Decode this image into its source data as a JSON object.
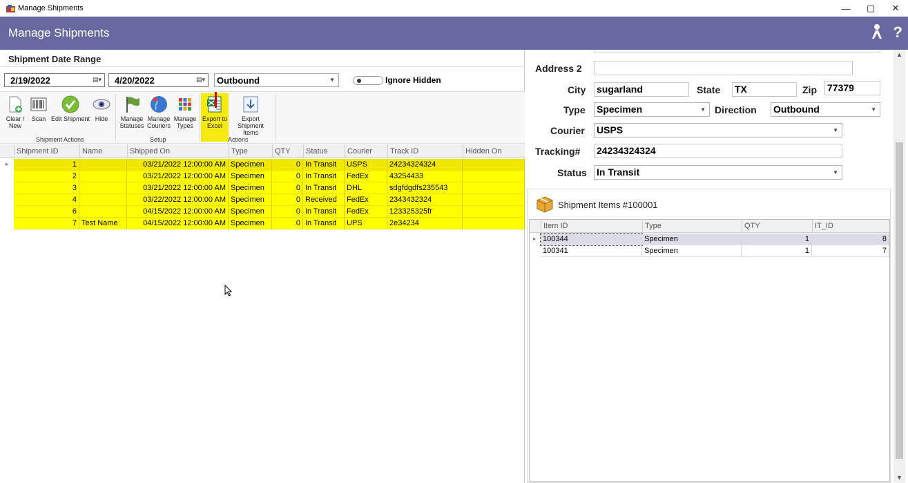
{
  "window": {
    "title": "Manage Shipments"
  },
  "header": {
    "title": "Manage Shipments"
  },
  "filters": {
    "section_label": "Shipment Date Range",
    "start_date": "2/19/2022",
    "end_date": "4/20/2022",
    "direction": "Outbound",
    "ignore_hidden_label": "Ignore Hidden"
  },
  "ribbon": {
    "clear_new": "Clear / New",
    "scan": "Scan",
    "edit_shipment": "Edit Shipment",
    "hide": "Hide",
    "shipment_actions_group": "Shipment Actions",
    "manage_statuses": "Manage Statuses",
    "manage_couriers": "Manage Couriers",
    "manage_types": "Manage Types",
    "setup_group": "Setup",
    "export_excel": "Export to Excel",
    "export_items": "Export Shipment Items",
    "actions_group": "Actions"
  },
  "grid": {
    "columns": [
      "Shipment ID",
      "Name",
      "Shipped On",
      "Type",
      "QTY",
      "Status",
      "Courier",
      "Track ID",
      "Hidden On"
    ],
    "rows": [
      [
        "1",
        "",
        "03/21/2022 12:00:00 AM",
        "Specimen",
        "0",
        "In Transit",
        "USPS",
        "24234324324",
        ""
      ],
      [
        "2",
        "",
        "03/21/2022 12:00:00 AM",
        "Specimen",
        "0",
        "In Transit",
        "FedEx",
        "43254433",
        ""
      ],
      [
        "3",
        "",
        "03/21/2022 12:00:00 AM",
        "Specimen",
        "0",
        "In Transit",
        "DHL",
        "sdgfdgdfs235543",
        ""
      ],
      [
        "4",
        "",
        "03/22/2022 12:00:00 AM",
        "Specimen",
        "0",
        "Received",
        "FedEx",
        "2343432324",
        ""
      ],
      [
        "6",
        "",
        "04/15/2022 12:00:00 AM",
        "Specimen",
        "0",
        "In Transit",
        "FedEx",
        "123325325fr",
        ""
      ],
      [
        "7",
        "Test Name",
        "04/15/2022 12:00:00 AM",
        "Specimen",
        "0",
        "In Transit",
        "UPS",
        "2e34234",
        ""
      ]
    ]
  },
  "details": {
    "address2_label": "Address 2",
    "address2_value": "",
    "city_label": "City",
    "city_value": "sugarland",
    "state_label": "State",
    "state_value": "TX",
    "zip_label": "Zip",
    "zip_value": "77379",
    "type_label": "Type",
    "type_value": "Specimen",
    "direction_label": "Direction",
    "direction_value": "Outbound",
    "courier_label": "Courier",
    "courier_value": "USPS",
    "tracking_label": "Tracking#",
    "tracking_value": "24234324324",
    "status_label": "Status",
    "status_value": "In Transit"
  },
  "items": {
    "title": "Shipment Items #100001",
    "columns": [
      "Item ID",
      "Type",
      "QTY",
      "IT_ID"
    ],
    "rows": [
      [
        "100344",
        "Specimen",
        "1",
        "8"
      ],
      [
        "100341",
        "Specimen",
        "1",
        "7"
      ]
    ]
  },
  "colors": {
    "header": "#6868a0",
    "row_highlight": "#ffff00",
    "button_highlight": "#f6ea10"
  }
}
